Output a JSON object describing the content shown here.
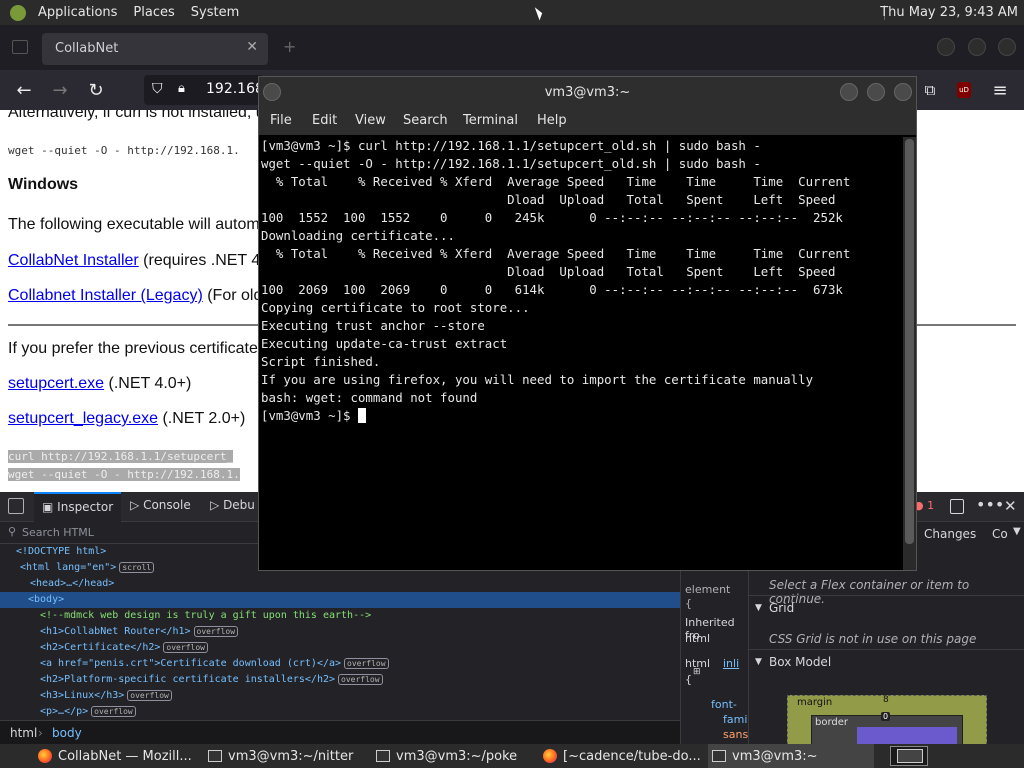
{
  "top_panel": {
    "menus": [
      "Applications",
      "Places",
      "System"
    ],
    "clock": "Thu May 23,  9:43 AM"
  },
  "browser": {
    "tab_title": "CollabNet",
    "url_partial": "192.168.",
    "ublock_badge": "uD",
    "page": {
      "intro_text": "Alternatively, if curl is not installed, u",
      "wget_line": "wget --quiet -O - http://192.168.1.",
      "windows_heading": "Windows",
      "windows_text": "The following executable will autom",
      "link1": "CollabNet Installer",
      "link1_suffix": " (requires .NET 4",
      "link2": "Collabnet Installer (Legacy)",
      "link2_suffix": " (For old",
      "prefer_text": "If you prefer the previous certificate",
      "link3": "setupcert.exe",
      "link3_suffix": " (.NET 4.0+)",
      "link4": "setupcert_legacy.exe",
      "link4_suffix": " (.NET 2.0+)",
      "code1": "curl http://192.168.1.1/setupcert_",
      "code2": "wget --quiet -O - http://192.168.1."
    },
    "devtools": {
      "tabs": [
        "Inspector",
        "Console",
        "Debu"
      ],
      "search_placeholder": "Search HTML",
      "right_tabs": [
        "Changes",
        "Co"
      ],
      "error_count": "1",
      "markup": [
        {
          "indent": 16,
          "html": "doctype",
          "text": "<!DOCTYPE html>"
        },
        {
          "indent": 20,
          "html": "html",
          "text": "<html lang=\"en\">",
          "badge": "scroll"
        },
        {
          "indent": 30,
          "html": "head",
          "text": "<head>…</head>"
        },
        {
          "indent": 28,
          "html": "body",
          "text": "<body>"
        },
        {
          "indent": 40,
          "html": "comment",
          "text": "<!--mdmck web design is truly a gift upon this earth-->"
        },
        {
          "indent": 40,
          "html": "h1",
          "text": "<h1>CollabNet Router</h1>",
          "badge": "overflow"
        },
        {
          "indent": 40,
          "html": "h2",
          "text": "<h2>Certificate</h2>",
          "badge": "overflow"
        },
        {
          "indent": 40,
          "html": "a",
          "text": "<a href=\"penis.crt\">Certificate download (crt)</a>",
          "badge": "overflow"
        },
        {
          "indent": 40,
          "html": "h2b",
          "text": "<h2>Platform-specific certificate installers</h2>",
          "badge": "overflow"
        },
        {
          "indent": 40,
          "html": "h3",
          "text": "<h3>Linux</h3>",
          "badge": "overflow"
        },
        {
          "indent": 40,
          "html": "p",
          "text": "<p>…</p>",
          "badge": "overflow"
        }
      ],
      "breadcrumbs": [
        "html",
        "body"
      ],
      "rules_panel": {
        "element_label": "element",
        "brace": "{",
        "inherited": "Inherited fro",
        "inherited_tag": "html",
        "rule_tag": "html",
        "rule_link": "inli",
        "rule_brace": "{",
        "prop1": "font-",
        "prop1b": "fami",
        "prop2": "sans"
      },
      "layout_panel": {
        "flex_hint": "Select a Flex container or item to continue.",
        "grid_label": "Grid",
        "grid_hint": "CSS Grid is not in use on this page",
        "box_model_label": "Box Model",
        "margin_label": "margin",
        "border_label": "border",
        "margin_value": "8",
        "border_value": "0"
      }
    }
  },
  "terminal": {
    "title": "vm3@vm3:~",
    "menu": [
      "File",
      "Edit",
      "View",
      "Search",
      "Terminal",
      "Help"
    ],
    "lines": [
      "[vm3@vm3 ~]$ curl http://192.168.1.1/setupcert_old.sh | sudo bash -",
      "wget --quiet -O - http://192.168.1.1/setupcert_old.sh | sudo bash -",
      "  % Total    % Received % Xferd  Average Speed   Time    Time     Time  Current",
      "                                 Dload  Upload   Total   Spent    Left  Speed",
      "100  1552  100  1552    0     0   245k      0 --:--:-- --:--:-- --:--:--  252k",
      "Downloading certificate...",
      "  % Total    % Received % Xferd  Average Speed   Time    Time     Time  Current",
      "                                 Dload  Upload   Total   Spent    Left  Speed",
      "100  2069  100  2069    0     0   614k      0 --:--:-- --:--:-- --:--:--  673k",
      "Copying certificate to root store...",
      "Executing trust anchor --store",
      "Executing update-ca-trust extract",
      "Script finished.",
      "If you are using firefox, you will need to import the certificate manually",
      "bash: wget: command not found"
    ],
    "prompt": "[vm3@vm3 ~]$ "
  },
  "taskbar": {
    "items": [
      {
        "label": "CollabNet — Mozill...",
        "icon": "firefox-icon"
      },
      {
        "label": "vm3@vm3:~/nitter",
        "icon": "terminal-icon"
      },
      {
        "label": "vm3@vm3:~/poke",
        "icon": "terminal-icon"
      },
      {
        "label": "[~cadence/tube-do...",
        "icon": "firefox-icon"
      },
      {
        "label": "vm3@vm3:~",
        "icon": "terminal-icon"
      }
    ]
  }
}
